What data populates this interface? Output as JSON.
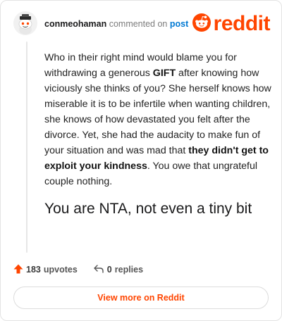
{
  "header": {
    "username": "conmeohaman",
    "action_text": "commented on",
    "post_link": "post",
    "logo_text": "reddit"
  },
  "comment": {
    "p1": "Who in their right mind would blame you for withdrawing a generous ",
    "b1": "GIFT",
    "p2": " after knowing how viciously she thinks of you? She herself knows how miserable it is to be infertile when wanting children, she knows of how devastated you felt after the divorce. Yet, she had the audacity to make fun of your situation and was mad that ",
    "b2": "they didn't get to exploit your kindness",
    "p3": ". You owe that ungrateful couple nothing.",
    "big": "You are NTA, not even a tiny bit"
  },
  "actions": {
    "upvotes_count": "183",
    "upvotes_label": "upvotes",
    "replies_count": "0",
    "replies_label": "replies"
  },
  "footer": {
    "view_more_label": "View more on Reddit"
  },
  "colors": {
    "brand": "#ff4500",
    "link": "#0079d3"
  },
  "icons": [
    "avatar-snoo-icon",
    "reddit-logo-icon",
    "upvote-arrow-icon",
    "reply-icon"
  ]
}
